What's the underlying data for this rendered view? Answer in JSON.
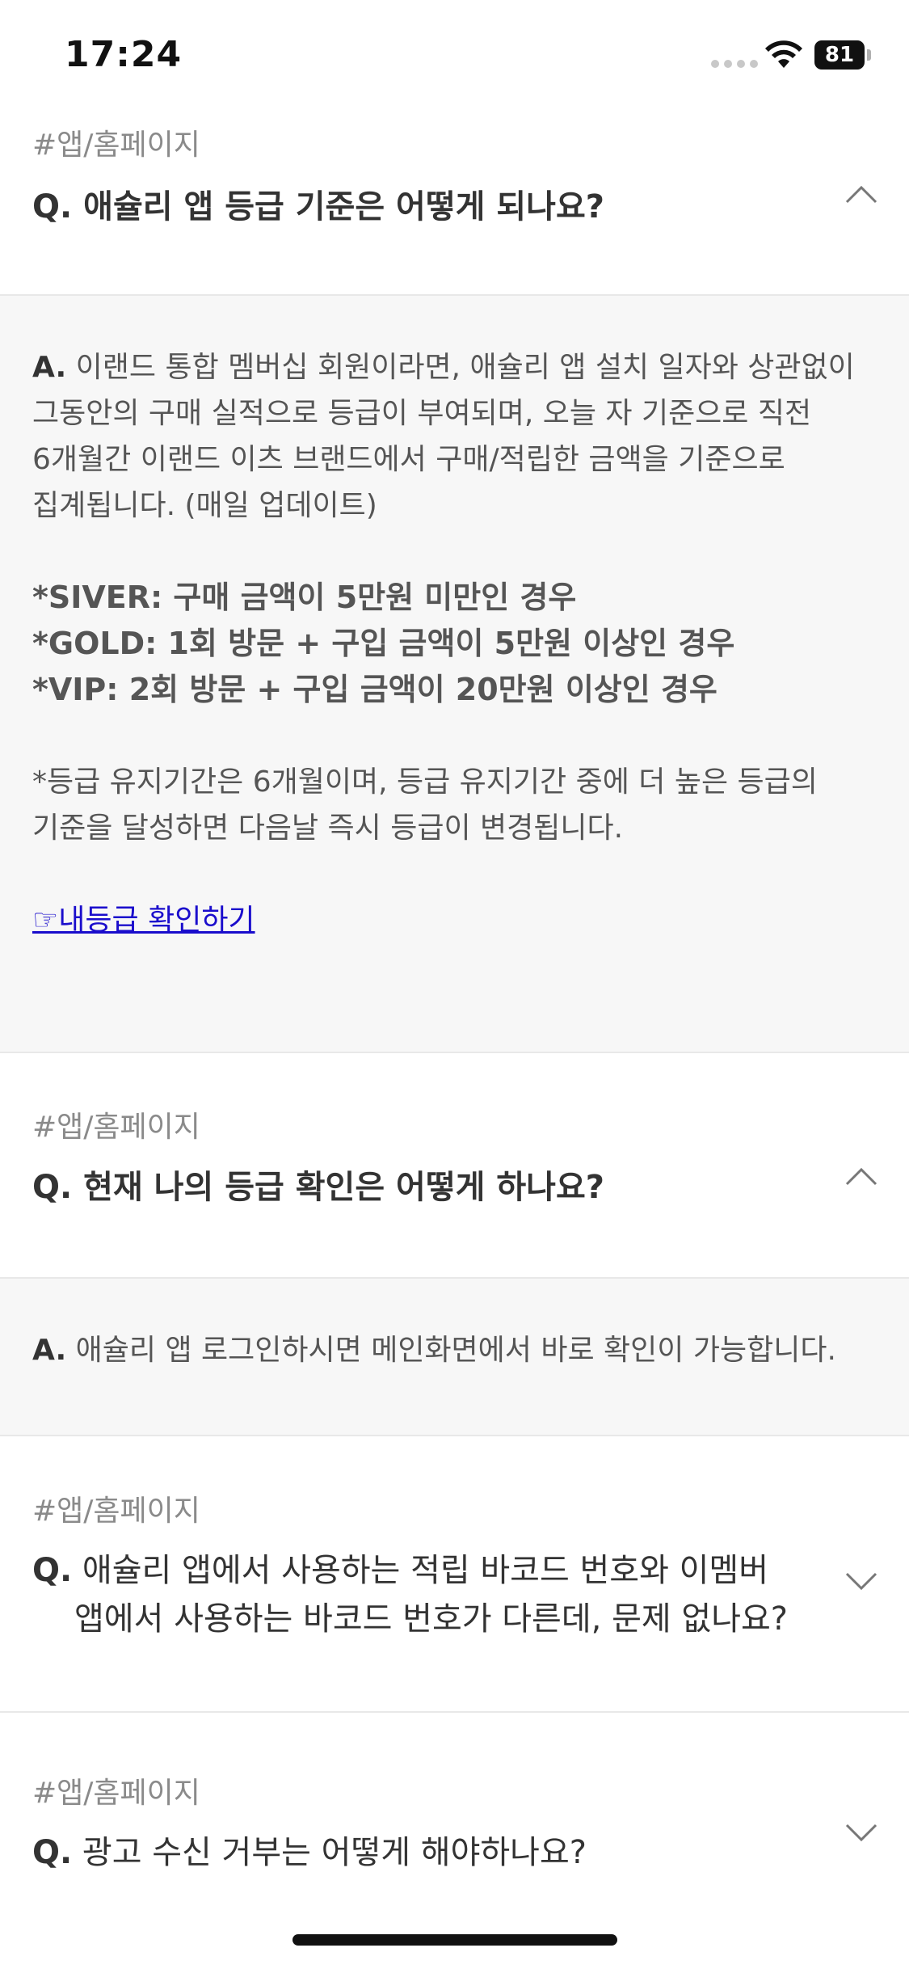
{
  "status_bar": {
    "time": "17:24",
    "battery": "81"
  },
  "faq": [
    {
      "tag": "#앱/홈페이지",
      "q_mark": "Q.",
      "question": "애슐리 앱 등급 기준은 어떻게 되나요?",
      "expanded": true,
      "answer": {
        "a_mark": "A.",
        "lines": [
          "이랜드 통합 멤버십 회원이라면, 애슐리 앱 설치 일자와 상관없이",
          "그동안의 구매 실적으로 등급이 부여되며, 오늘 자 기준으로 직전",
          "6개월간 이랜드 이츠 브랜드에서 구매/적립한 금액을 기준으로",
          "집계됩니다. (매일 업데이트)"
        ],
        "tiers": [
          "*SIVER: 구매 금액이 5만원 미만인 경우",
          "*GOLD: 1회 방문 + 구입 금액이 5만원 이상인 경우",
          "*VIP: 2회 방문 + 구입 금액이 20만원 이상인 경우"
        ],
        "note_lines": [
          "*등급 유지기간은 6개월이며, 등급 유지기간 중에 더 높은 등급의",
          "기준을 달성하면 다음날 즉시 등급이 변경됩니다."
        ],
        "link": "☞내등급 확인하기"
      }
    },
    {
      "tag": "#앱/홈페이지",
      "q_mark": "Q.",
      "question": "현재 나의 등급 확인은 어떻게 하나요?",
      "expanded": true,
      "answer": {
        "a_mark": "A.",
        "text": "애슐리 앱 로그인하시면 메인화면에서 바로 확인이 가능합니다."
      }
    },
    {
      "tag": "#앱/홈페이지",
      "q_mark": "Q.",
      "question_lines": [
        "애슐리 앱에서 사용하는 적립 바코드 번호와 이멤버",
        "앱에서 사용하는 바코드 번호가 다른데, 문제 없나요?"
      ],
      "expanded": false
    },
    {
      "tag": "#앱/홈페이지",
      "q_mark": "Q.",
      "question": "광고 수신 거부는 어떻게 해야하나요?",
      "expanded": false
    }
  ],
  "icons": {
    "wifi": "wifi-icon",
    "battery": "battery-icon",
    "chevron_up": "chevron-up-icon",
    "chevron_down": "chevron-down-icon"
  },
  "colors": {
    "background": "#ffffff",
    "answer_background": "#f7f7f7",
    "link": "#1a0dcc",
    "tag": "#8a8a8a",
    "divider": "#e8e8e8"
  }
}
